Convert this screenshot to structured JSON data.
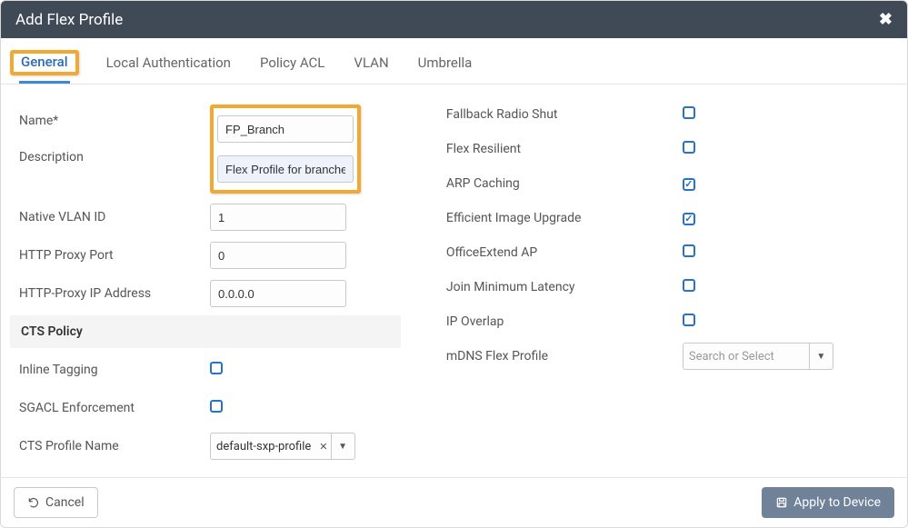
{
  "header": {
    "title": "Add Flex Profile"
  },
  "tabs": {
    "general": "General",
    "local_auth": "Local Authentication",
    "policy_acl": "Policy ACL",
    "vlan": "VLAN",
    "umbrella": "Umbrella"
  },
  "general": {
    "name_label": "Name*",
    "name_value": "FP_Branch",
    "description_label": "Description",
    "description_value": "Flex Profile for branches",
    "native_vlan_label": "Native VLAN ID",
    "native_vlan_value": "1",
    "http_proxy_port_label": "HTTP Proxy Port",
    "http_proxy_port_value": "0",
    "http_proxy_ip_label": "HTTP-Proxy IP Address",
    "http_proxy_ip_value": "0.0.0.0",
    "cts_section": "CTS Policy",
    "inline_tagging_label": "Inline Tagging",
    "inline_tagging_checked": false,
    "sgacl_label": "SGACL Enforcement",
    "sgacl_checked": false,
    "cts_profile_label": "CTS Profile Name",
    "cts_profile_value": "default-sxp-profile"
  },
  "right": {
    "fallback_radio_label": "Fallback Radio Shut",
    "fallback_radio_checked": false,
    "flex_resilient_label": "Flex Resilient",
    "flex_resilient_checked": false,
    "arp_caching_label": "ARP Caching",
    "arp_caching_checked": true,
    "efficient_image_label": "Efficient Image Upgrade",
    "efficient_image_checked": true,
    "officeextend_label": "OfficeExtend AP",
    "officeextend_checked": false,
    "join_min_latency_label": "Join Minimum Latency",
    "join_min_latency_checked": false,
    "ip_overlap_label": "IP Overlap",
    "ip_overlap_checked": false,
    "mdns_label": "mDNS Flex Profile",
    "mdns_placeholder": "Search or Select"
  },
  "footer": {
    "cancel_label": "Cancel",
    "apply_label": "Apply to Device"
  }
}
